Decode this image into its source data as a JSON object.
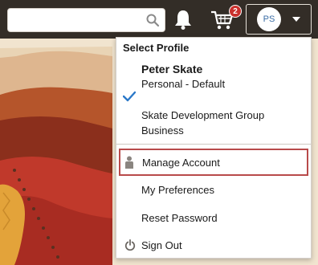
{
  "search": {
    "placeholder": "",
    "value": ""
  },
  "header": {
    "bell_icon": "bell-icon",
    "cart_icon": "cart-icon",
    "cart_badge": "2",
    "avatar_initials": "PS",
    "colors": {
      "bar": "#332d27",
      "badge": "#c9302c",
      "avatar_text": "#3c6ea6"
    }
  },
  "profile_menu": {
    "title": "Select Profile",
    "profiles": [
      {
        "name": "Peter Skate",
        "type": "Personal - Default",
        "selected": true
      },
      {
        "name": "Skate Development Group",
        "type": "Business",
        "selected": false
      }
    ],
    "items": [
      {
        "label": "Manage Account",
        "icon": "person-icon",
        "highlighted": true
      },
      {
        "label": "My Preferences"
      },
      {
        "label": "Reset Password"
      },
      {
        "label": "Sign Out",
        "icon": "power-icon"
      }
    ],
    "colors": {
      "check": "#2a78c8",
      "highlight_border": "#b84a4a"
    }
  }
}
